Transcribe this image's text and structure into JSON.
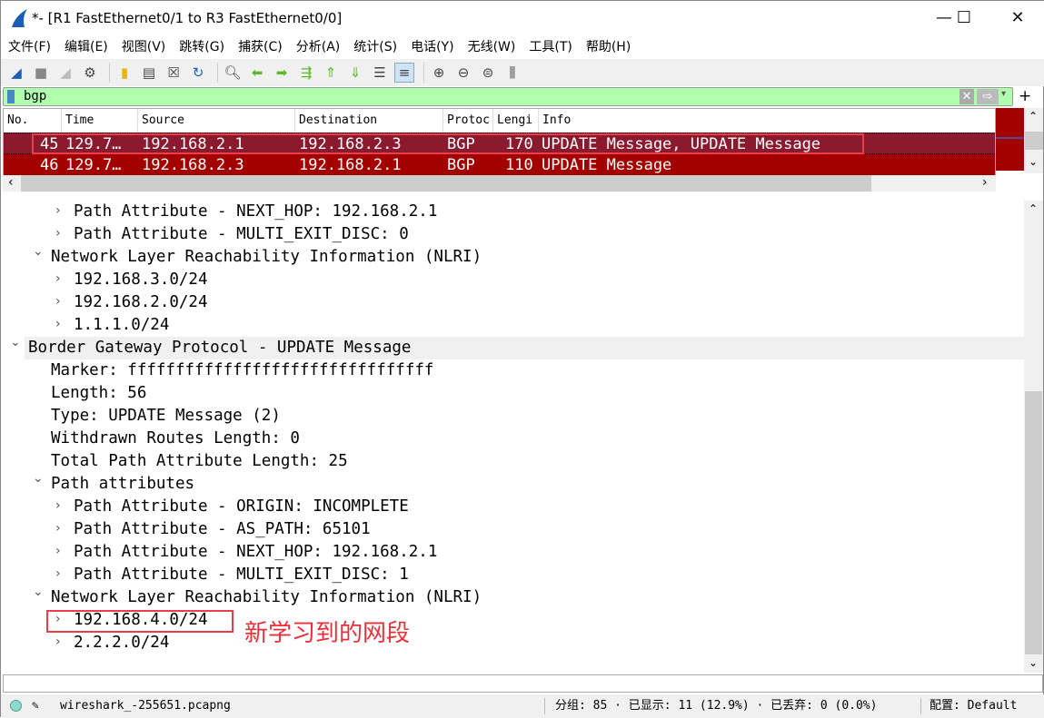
{
  "window": {
    "title": "*- [R1 FastEthernet0/1 to R3 FastEthernet0/0]",
    "minimize": "—",
    "maximize": "☐",
    "close": "✕"
  },
  "menu": [
    "文件(F)",
    "编辑(E)",
    "视图(V)",
    "跳转(G)",
    "捕获(C)",
    "分析(A)",
    "统计(S)",
    "电话(Y)",
    "无线(W)",
    "工具(T)",
    "帮助(H)"
  ],
  "filter": {
    "value": "bgp",
    "plus": "+"
  },
  "packet_list": {
    "columns": [
      "No.",
      "Time",
      "Source",
      "Destination",
      "Protoc",
      "Lengi",
      "Info"
    ],
    "rows": [
      {
        "no": "45",
        "time": "129.7…",
        "source": "192.168.2.1",
        "destination": "192.168.2.3",
        "protocol": "BGP",
        "length": "170",
        "info": "UPDATE Message, UPDATE Message",
        "selected": true
      },
      {
        "no": "46",
        "time": "129.7…",
        "source": "192.168.2.3",
        "destination": "192.168.2.1",
        "protocol": "BGP",
        "length": "110",
        "info": "UPDATE Message",
        "selected": false
      }
    ],
    "colors": {
      "selected": "#8b1a2e",
      "row": "#a40000"
    }
  },
  "details": [
    {
      "text": "Path Attribute - NEXT_HOP: 192.168.2.1",
      "level": 2,
      "chev": "›"
    },
    {
      "text": "Path Attribute - MULTI_EXIT_DISC: 0",
      "level": 2,
      "chev": "›"
    },
    {
      "text": "Network Layer Reachability Information (NLRI)",
      "level": 1,
      "chev": "⌄"
    },
    {
      "text": "192.168.3.0/24",
      "level": 2,
      "chev": "›"
    },
    {
      "text": "192.168.2.0/24",
      "level": 2,
      "chev": "›"
    },
    {
      "text": "1.1.1.0/24",
      "level": 2,
      "chev": "›"
    },
    {
      "text": "Border Gateway Protocol - UPDATE Message",
      "level": 0,
      "chev": "⌄"
    },
    {
      "text": "Marker: ffffffffffffffffffffffffffffffff",
      "level": 1,
      "chev": ""
    },
    {
      "text": "Length: 56",
      "level": 1,
      "chev": ""
    },
    {
      "text": "Type: UPDATE Message (2)",
      "level": 1,
      "chev": ""
    },
    {
      "text": "Withdrawn Routes Length: 0",
      "level": 1,
      "chev": ""
    },
    {
      "text": "Total Path Attribute Length: 25",
      "level": 1,
      "chev": ""
    },
    {
      "text": "Path attributes",
      "level": 1,
      "chev": "⌄"
    },
    {
      "text": "Path Attribute - ORIGIN: INCOMPLETE",
      "level": 2,
      "chev": "›"
    },
    {
      "text": "Path Attribute - AS_PATH: 65101",
      "level": 2,
      "chev": "›"
    },
    {
      "text": "Path Attribute - NEXT_HOP: 192.168.2.1",
      "level": 2,
      "chev": "›"
    },
    {
      "text": "Path Attribute - MULTI_EXIT_DISC: 1",
      "level": 2,
      "chev": "›"
    },
    {
      "text": "Network Layer Reachability Information (NLRI)",
      "level": 1,
      "chev": "⌄"
    },
    {
      "text": "192.168.4.0/24",
      "level": 2,
      "chev": "›"
    },
    {
      "text": "2.2.2.0/24",
      "level": 2,
      "chev": "›"
    }
  ],
  "annotation": "新学习到的网段",
  "status": {
    "file": "wireshark_-255651.pcapng",
    "packets": "分组: 85 · 已显示: 11 (12.9%) · 已丢弃: 0 (0.0%)",
    "profile": "配置: Default"
  }
}
